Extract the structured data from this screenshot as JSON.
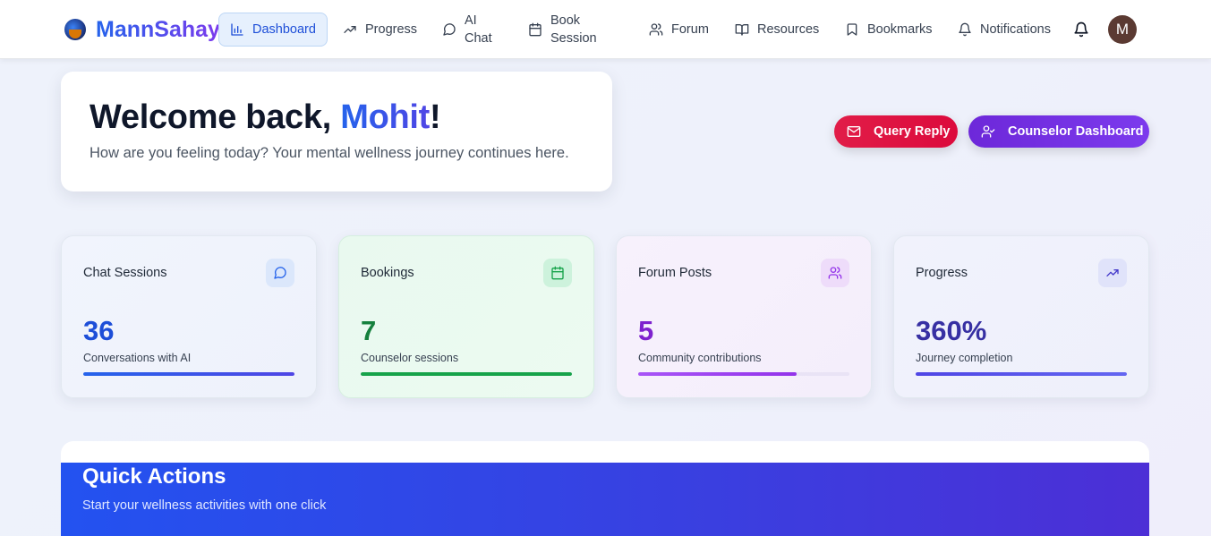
{
  "brand": {
    "name": "MannSahay"
  },
  "nav": {
    "items": [
      {
        "label": "Dashboard",
        "icon": "bar-chart-icon",
        "active": true
      },
      {
        "label": "Progress",
        "icon": "trending-up-icon"
      },
      {
        "label": "AI Chat",
        "icon": "chat-bubble-icon"
      },
      {
        "label": "Book Session",
        "icon": "calendar-icon"
      },
      {
        "label": "Forum",
        "icon": "users-icon"
      },
      {
        "label": "Resources",
        "icon": "book-open-icon"
      },
      {
        "label": "Bookmarks",
        "icon": "bookmark-icon"
      },
      {
        "label": "Notifications",
        "icon": "bell-icon"
      }
    ],
    "avatar_initial": "M"
  },
  "welcome": {
    "greeting": "Welcome back, ",
    "name": "Mohit",
    "punct": "!",
    "subtitle": "How are you feeling today? Your mental wellness journey continues here."
  },
  "actions": {
    "query_reply": "Query Reply",
    "counselor_dashboard": "Counselor Dashboard"
  },
  "stats": [
    {
      "title": "Chat Sessions",
      "value": "36",
      "subtitle": "Conversations with AI",
      "icon": "chat-bubble-icon",
      "progress": 1.0,
      "color": "#1d4ed8"
    },
    {
      "title": "Bookings",
      "value": "7",
      "subtitle": "Counselor sessions",
      "icon": "calendar-icon",
      "progress": 1.0,
      "color": "#15803d"
    },
    {
      "title": "Forum Posts",
      "value": "5",
      "subtitle": "Community contributions",
      "icon": "users-icon",
      "progress": 0.75,
      "color": "#7e22ce"
    },
    {
      "title": "Progress",
      "value": "360%",
      "subtitle": "Journey completion",
      "icon": "trending-up-icon",
      "progress": 1.0,
      "color": "#3730a3"
    }
  ],
  "quick_actions": {
    "title": "Quick Actions",
    "subtitle": "Start your wellness activities with one click"
  }
}
